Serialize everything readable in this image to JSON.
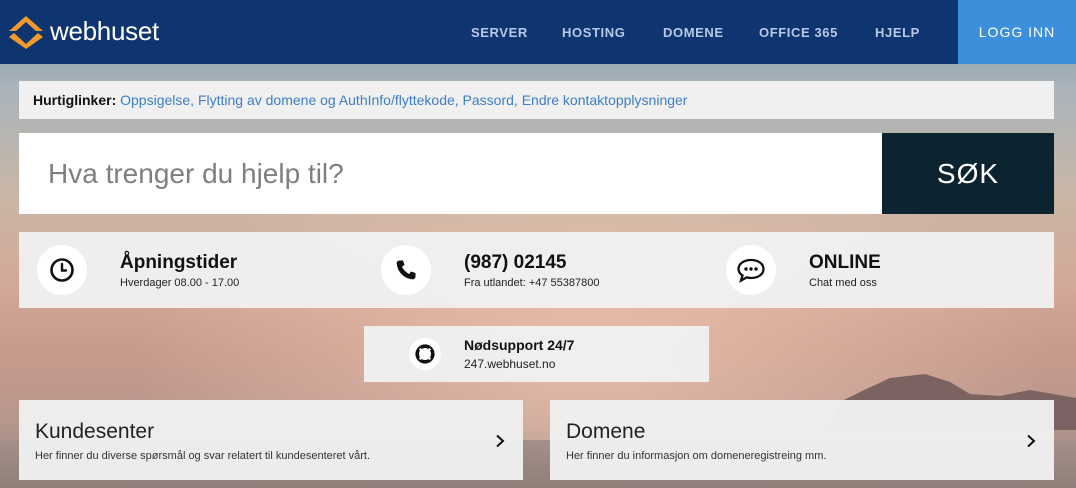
{
  "brand": {
    "name": "webhuset",
    "accent": "#f29b2c",
    "header_bg": "#0f3570",
    "login_bg": "#3d8fdb"
  },
  "nav": {
    "items": [
      {
        "label": "SERVER"
      },
      {
        "label": "HOSTING"
      },
      {
        "label": "DOMENE"
      },
      {
        "label": "OFFICE 365"
      },
      {
        "label": "HJELP"
      }
    ],
    "login_label": "LOGG INN"
  },
  "quicklinks": {
    "label": "Hurtiglinker:",
    "links": [
      "Oppsigelse",
      "Flytting av domene og AuthInfo/flyttekode",
      "Passord",
      "Endre kontaktopplysninger"
    ],
    "links_text": "Oppsigelse, Flytting av domene og AuthInfo/flyttekode, Passord, Endre kontaktopplysninger"
  },
  "search": {
    "placeholder": "Hva trenger du hjelp til?",
    "value": "",
    "button_label": "SØK"
  },
  "contact": {
    "hours": {
      "icon": "clock-icon",
      "title": "Åpningstider",
      "subtitle": "Hverdager 08.00 - 17.00"
    },
    "phone": {
      "icon": "phone-icon",
      "title": "(987) 02145",
      "subtitle": "Fra utlandet: +47 55387800"
    },
    "chat": {
      "icon": "chat-icon",
      "title": "ONLINE",
      "subtitle": "Chat med oss"
    }
  },
  "emergency": {
    "icon": "lifebuoy-icon",
    "title": "Nødsupport 24/7",
    "subtitle": "247.webhuset.no"
  },
  "cards": [
    {
      "title": "Kundesenter",
      "subtitle": "Her finner du diverse spørsmål og svar relatert til kundesenteret vårt."
    },
    {
      "title": "Domene",
      "subtitle": "Her finner du informasjon om domeneregistreing mm."
    }
  ]
}
